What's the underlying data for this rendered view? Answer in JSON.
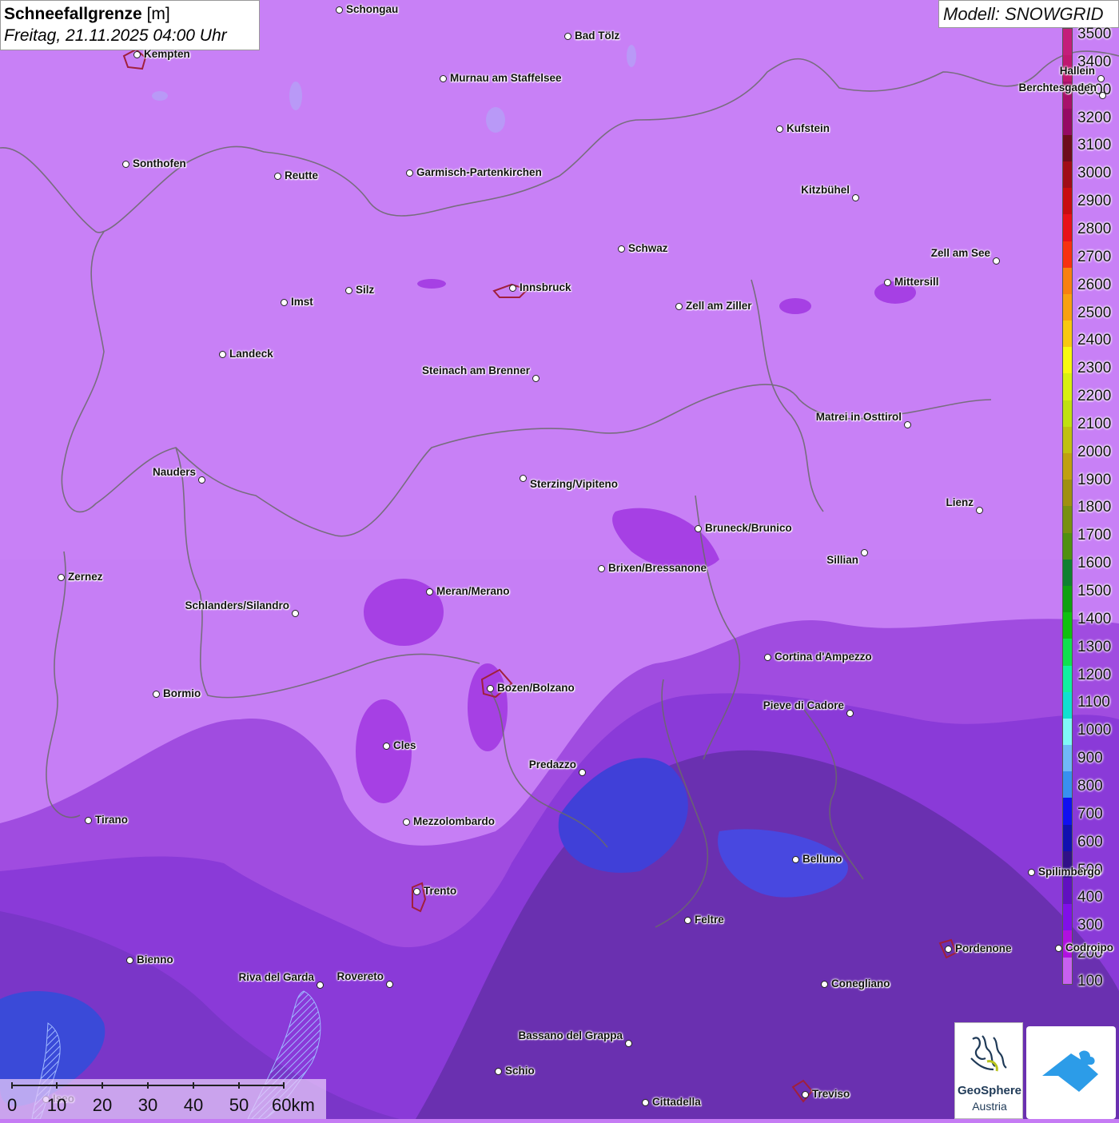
{
  "header": {
    "title_bold": "Schneefallgrenze",
    "title_unit": "[m]",
    "datetime": "Freitag, 21.11.2025 04:00 Uhr"
  },
  "model_label": "Modell: SNOWGRID",
  "legend": {
    "labels": [
      "3500",
      "3400",
      "3300",
      "3200",
      "3100",
      "3000",
      "2900",
      "2800",
      "2700",
      "2600",
      "2500",
      "2400",
      "2300",
      "2200",
      "2100",
      "2000",
      "1900",
      "1800",
      "1700",
      "1600",
      "1500",
      "1400",
      "1300",
      "1200",
      "1100",
      "1000",
      "900",
      "800",
      "700",
      "600",
      "500",
      "400",
      "300",
      "200",
      "100"
    ],
    "colors": [
      "#c41e7a",
      "#c01870",
      "#a8106a",
      "#960a64",
      "#6e0c1c",
      "#a00c18",
      "#c80c10",
      "#e8101a",
      "#f83010",
      "#f88010",
      "#f8a010",
      "#f8c810",
      "#f8f810",
      "#d8f010",
      "#c0e010",
      "#c0c010",
      "#c0a010",
      "#a09010",
      "#789010",
      "#509010",
      "#108030",
      "#10a010",
      "#10c010",
      "#10e050",
      "#10f0a0",
      "#10e0d0",
      "#80f8f8",
      "#70b8f8",
      "#3890f0",
      "#1010f0",
      "#1010b0",
      "#301088",
      "#6010c0",
      "#8010e8",
      "#b010e0",
      "#c860f0"
    ],
    "unit": "m"
  },
  "places": [
    {
      "name": "Schongau"
    },
    {
      "name": "Bad Tölz"
    },
    {
      "name": "Kempten"
    },
    {
      "name": "Murnau am Staffelsee"
    },
    {
      "name": "Hallein"
    },
    {
      "name": "Berchtesgaden"
    },
    {
      "name": "Kufstein"
    },
    {
      "name": "Sonthofen"
    },
    {
      "name": "Reutte"
    },
    {
      "name": "Garmisch-Partenkirchen"
    },
    {
      "name": "Kitzbühel"
    },
    {
      "name": "Schwaz"
    },
    {
      "name": "Zell am See"
    },
    {
      "name": "Innsbruck"
    },
    {
      "name": "Mittersill"
    },
    {
      "name": "Silz"
    },
    {
      "name": "Imst"
    },
    {
      "name": "Zell am Ziller"
    },
    {
      "name": "Landeck"
    },
    {
      "name": "Steinach am Brenner"
    },
    {
      "name": "Matrei in Osttirol"
    },
    {
      "name": "Nauders"
    },
    {
      "name": "Sterzing/Vipiteno"
    },
    {
      "name": "Lienz"
    },
    {
      "name": "Bruneck/Brunico"
    },
    {
      "name": "Sillian"
    },
    {
      "name": "Zernez"
    },
    {
      "name": "Brixen/Bressanone"
    },
    {
      "name": "Meran/Merano"
    },
    {
      "name": "Schlanders/Silandro"
    },
    {
      "name": "Cortina d'Ampezzo"
    },
    {
      "name": "Bozen/Bolzano"
    },
    {
      "name": "Bormio"
    },
    {
      "name": "Pieve di Cadore"
    },
    {
      "name": "Cles"
    },
    {
      "name": "Predazzo"
    },
    {
      "name": "Tirano"
    },
    {
      "name": "Mezzolombardo"
    },
    {
      "name": "Belluno"
    },
    {
      "name": "Spilimbergo"
    },
    {
      "name": "Trento"
    },
    {
      "name": "Feltre"
    },
    {
      "name": "Pordenone"
    },
    {
      "name": "Codroipo"
    },
    {
      "name": "Bienno"
    },
    {
      "name": "Riva del Garda"
    },
    {
      "name": "Rovereto"
    },
    {
      "name": "Conegliano"
    },
    {
      "name": "Bassano del Grappa"
    },
    {
      "name": "Schio"
    },
    {
      "name": "Treviso"
    },
    {
      "name": "Cittadella"
    },
    {
      "name": "Iseo"
    }
  ],
  "scale_bar": {
    "labels": [
      "0",
      "10",
      "20",
      "30",
      "40",
      "50",
      "60km"
    ]
  },
  "logos": {
    "geosphere_line1": "GeoSphere",
    "geosphere_line2": "Austria",
    "app_icon": "snowgrid-app-icon"
  }
}
